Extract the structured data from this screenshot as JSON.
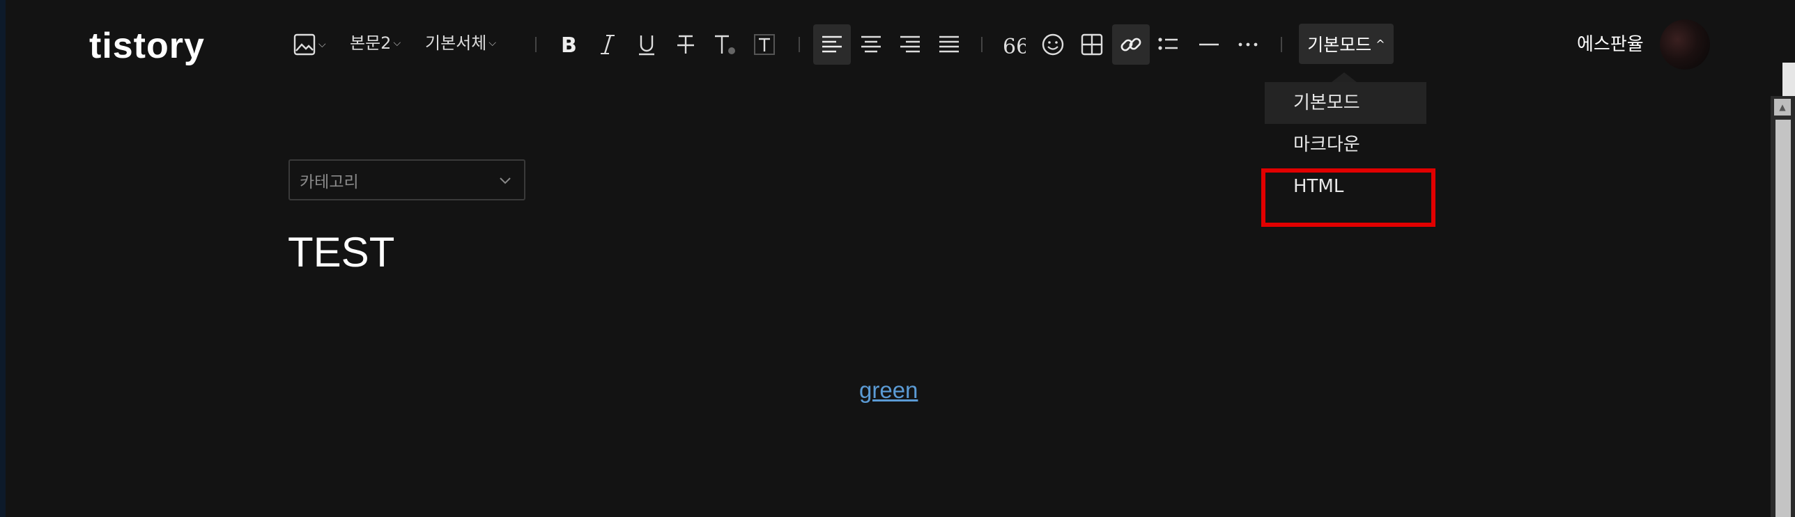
{
  "header": {
    "logo": "tistory",
    "user_name": "에스판율"
  },
  "toolbar": {
    "paragraph_style": "본문2",
    "font": "기본서체",
    "mode_label": "기본모드"
  },
  "mode_menu": {
    "items": [
      "기본모드",
      "마크다운",
      "HTML"
    ],
    "selected_index": 0
  },
  "editor": {
    "category_placeholder": "카테고리",
    "post_title": "TEST",
    "link_text": "green"
  },
  "colors": {
    "background": "#131313",
    "highlight_box": "#e10000",
    "link": "#5b9bd5"
  }
}
